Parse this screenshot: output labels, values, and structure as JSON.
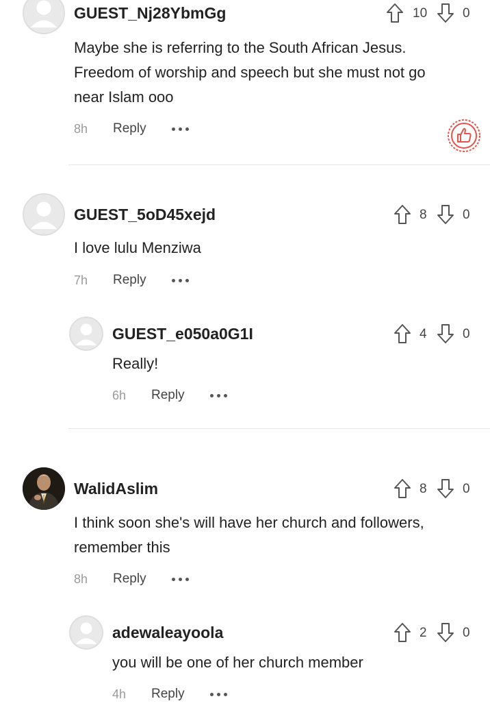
{
  "comments": [
    {
      "username": "GUEST_Nj28YbmGg",
      "text_lines": [
        "Maybe she is referring to the South African Jesus.",
        "Freedom of worship and speech but she must not go",
        "near Islam ooo"
      ],
      "time": "8h",
      "reply": "Reply",
      "upvotes": "10",
      "downvotes": "0"
    },
    {
      "username": "GUEST_5oD45xejd",
      "text_lines": [
        "I love lulu Menziwa"
      ],
      "time": "7h",
      "reply": "Reply",
      "upvotes": "8",
      "downvotes": "0",
      "replies": [
        {
          "username": "GUEST_e050a0G1I",
          "text_lines": [
            "Really!"
          ],
          "time": "6h",
          "reply": "Reply",
          "upvotes": "4",
          "downvotes": "0"
        }
      ]
    },
    {
      "username": "WalidAslim",
      "text_lines": [
        "I think soon she's will have her church and followers,",
        "remember this"
      ],
      "time": "8h",
      "reply": "Reply",
      "upvotes": "8",
      "downvotes": "0",
      "replies": [
        {
          "username": "adewaleayoola",
          "text_lines": [
            "you will be one of her church member"
          ],
          "time": "4h",
          "reply": "Reply",
          "upvotes": "2",
          "downvotes": "0"
        }
      ]
    }
  ],
  "icons": {
    "upvote": "arrow-up-outline-icon",
    "downvote": "arrow-down-outline-icon",
    "more": "more-dots-icon",
    "avatar_default": "default-avatar-icon",
    "like_badge": "thumbs-up-badge-icon"
  },
  "colors": {
    "accent": "#e8524a",
    "text": "#222222",
    "muted": "#9a9a9a",
    "divider": "#e6e6e6"
  }
}
